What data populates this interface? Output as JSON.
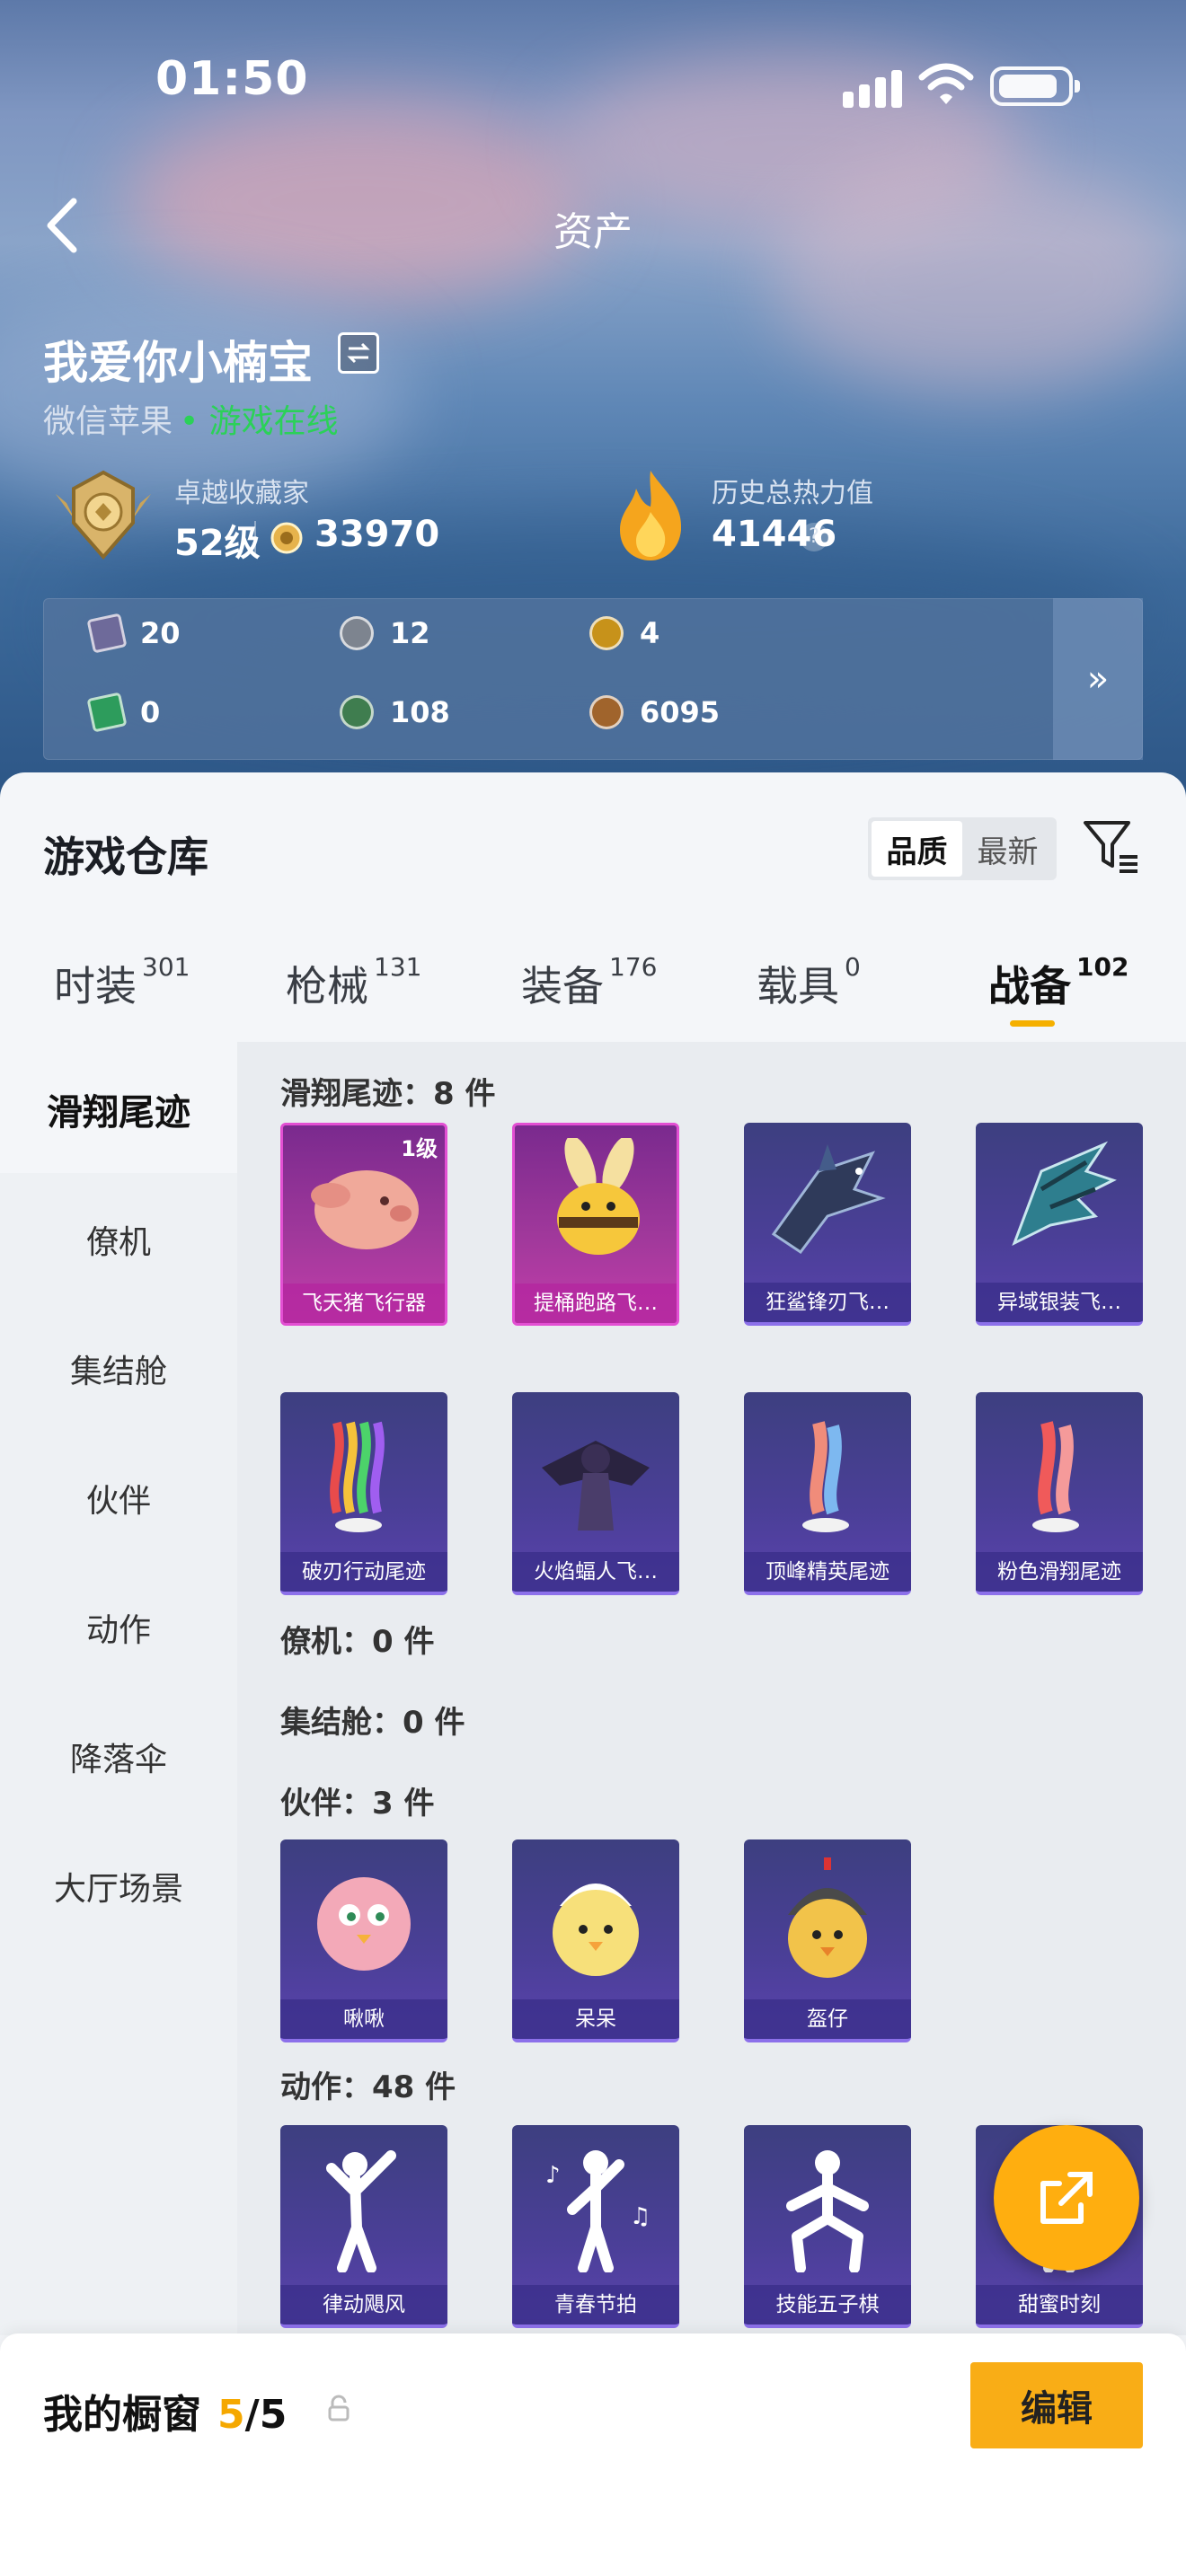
{
  "status": {
    "time": "01:50"
  },
  "nav": {
    "title": "资产"
  },
  "profile": {
    "name": "我爱你小楠宝",
    "platform": "微信苹果",
    "online": "• 游戏在线",
    "collector_label": "卓越收藏家",
    "level": "52级",
    "points": "33970",
    "heat_label": "历史总热力值",
    "heat": "41446"
  },
  "resources": [
    {
      "icon": "purple-card-icon",
      "value": "20",
      "color": "#6e6a9a"
    },
    {
      "icon": "gray-coin-icon",
      "value": "12",
      "color": "#7d848f"
    },
    {
      "icon": "gold-coin-icon",
      "value": "4",
      "color": "#c7921a"
    },
    {
      "icon": "green-card-icon",
      "value": "0",
      "color": "#2d9c5c"
    },
    {
      "icon": "green-orb-icon",
      "value": "108",
      "color": "#3f7d4f"
    },
    {
      "icon": "bronze-coin-icon",
      "value": "6095",
      "color": "#a0642c"
    }
  ],
  "warehouse": {
    "title": "游戏仓库",
    "sort": [
      "品质",
      "最新"
    ]
  },
  "tabs": [
    {
      "label": "时装",
      "count": "301"
    },
    {
      "label": "枪械",
      "count": "131"
    },
    {
      "label": "装备",
      "count": "176"
    },
    {
      "label": "载具",
      "count": "0"
    },
    {
      "label": "战备",
      "count": "102"
    }
  ],
  "sidebar": [
    "滑翔尾迹",
    "僚机",
    "集结舱",
    "伙伴",
    "动作",
    "降落伞",
    "大厅场景"
  ],
  "sections": [
    {
      "title": "滑翔尾迹：8 件",
      "items": [
        {
          "name": "飞天猪飞行器",
          "badge": "1级",
          "style": "pink",
          "icon": "pig-icon"
        },
        {
          "name": "提桶跑路飞…",
          "style": "pink",
          "icon": "bee-icon"
        },
        {
          "name": "狂鲨锋刃飞…",
          "style": "purple",
          "icon": "shark-icon"
        },
        {
          "name": "异域银装飞…",
          "style": "purple",
          "icon": "wing-icon"
        },
        {
          "name": "破刃行动尾迹",
          "style": "purple",
          "icon": "rainbow-trail-icon"
        },
        {
          "name": "火焰蝠人飞…",
          "style": "purple",
          "icon": "batman-icon"
        },
        {
          "name": "顶峰精英尾迹",
          "style": "purple",
          "icon": "blue-trail-icon"
        },
        {
          "name": "粉色滑翔尾迹",
          "style": "purple",
          "icon": "red-trail-icon"
        }
      ]
    },
    {
      "title": "僚机：0 件",
      "items": []
    },
    {
      "title": "集结舱：0 件",
      "items": []
    },
    {
      "title": "伙伴：3 件",
      "items": [
        {
          "name": "啾啾",
          "style": "purple",
          "icon": "pink-chick-icon"
        },
        {
          "name": "呆呆",
          "style": "purple",
          "icon": "yellow-chick-icon"
        },
        {
          "name": "盔仔",
          "style": "purple",
          "icon": "helmet-chick-icon"
        }
      ]
    },
    {
      "title": "动作：48 件",
      "items": [
        {
          "name": "律动飓风",
          "style": "purple",
          "icon": "dance-pose-icon"
        },
        {
          "name": "青春节拍",
          "style": "purple",
          "icon": "music-pose-icon"
        },
        {
          "name": "技能五子棋",
          "style": "purple",
          "icon": "squat-pose-icon"
        },
        {
          "name": "甜蜜时刻",
          "style": "purple",
          "icon": "sweet-pose-icon"
        }
      ]
    }
  ],
  "showcase": {
    "title": "我的橱窗",
    "count": "5",
    "total": "/5",
    "edit": "编辑"
  }
}
